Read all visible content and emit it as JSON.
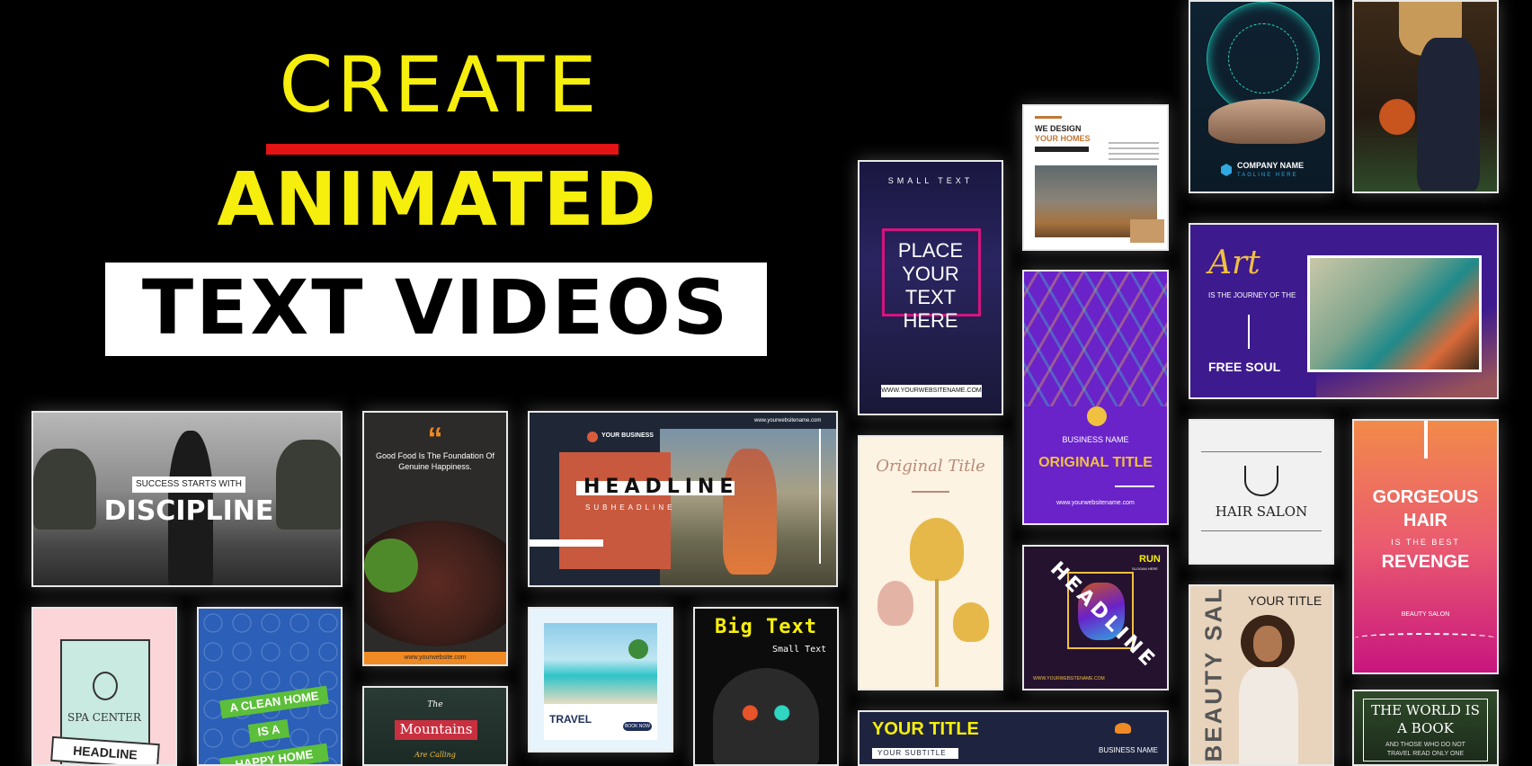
{
  "hero": {
    "line1": "CREATE",
    "line2": "ANIMATED",
    "line3": "TEXT VIDEOS"
  },
  "colors": {
    "yellow": "#f6ee0c",
    "red": "#e41414",
    "purple": "#6a22c9",
    "pink": "#d4147f",
    "orange": "#f08a24"
  },
  "tiles": {
    "discipline": {
      "small": "SUCCESS STARTS WITH",
      "big": "DISCIPLINE"
    },
    "food": {
      "quote": "“",
      "text": "Good Food Is The Foundation Of Genuine Happiness.",
      "url": "www.yourwebsite.com"
    },
    "headline": {
      "business": "YOUR BUSINESS",
      "url": "www.yourwebsitename.com",
      "headline": "HEADLINE",
      "sub": "SUBHEADLINE"
    },
    "place": {
      "small": "SMALL TEXT",
      "line1": "PLACE",
      "line2": "YOUR",
      "line3": "TEXT",
      "line4": "HERE",
      "url": "WWW.YOURWEBSITENAME.COM"
    },
    "design": {
      "line1": "WE DESIGN",
      "line2": "YOUR HOMES"
    },
    "company": {
      "name": "COMPANY NAME",
      "tag": "TAGLINE HERE"
    },
    "art": {
      "title": "Art",
      "sub": "IS THE JOURNEY OF THE",
      "bottom": "FREE SOUL"
    },
    "business": {
      "name": "BUSINESS NAME",
      "title": "ORIGINAL TITLE",
      "url": "www.yourwebsitename.com"
    },
    "original": {
      "title": "Original Title"
    },
    "salon": {
      "name": "HAIR SALON"
    },
    "gorgeous": {
      "line1": "GORGEOUS",
      "line2": "HAIR",
      "line3": "IS THE BEST",
      "line4": "REVENGE",
      "sub": "BEAUTY SALON"
    },
    "spa": {
      "name": "SPA CENTER",
      "ribbon": "HEADLINE"
    },
    "clean": {
      "line1": "A CLEAN HOME",
      "line2": "IS A",
      "line3": "HAPPY HOME"
    },
    "mountains": {
      "the": "The",
      "name": "Mountains",
      "sub": "Are Calling"
    },
    "travel": {
      "title": "TRAVEL",
      "btn": "BOOK NOW"
    },
    "bigtext": {
      "title": "Big Text",
      "sub": "Small Text"
    },
    "run": {
      "logo": "RUN",
      "tag": "SLOGAN HERE",
      "headline": "HEADLINE",
      "url": "WWW.YOURWEBSITENAME.COM"
    },
    "beauty": {
      "title": "YOUR TITLE",
      "side": "BEAUTY SALON"
    },
    "yourtitle": {
      "title": "YOUR TITLE",
      "sub": "YOUR SUBTITLE",
      "business": "BUSINESS NAME"
    },
    "world": {
      "line1": "THE WORLD IS",
      "line2": "A BOOK",
      "line3": "AND THOSE WHO DO NOT",
      "line4": "TRAVEL READ ONLY ONE"
    }
  }
}
